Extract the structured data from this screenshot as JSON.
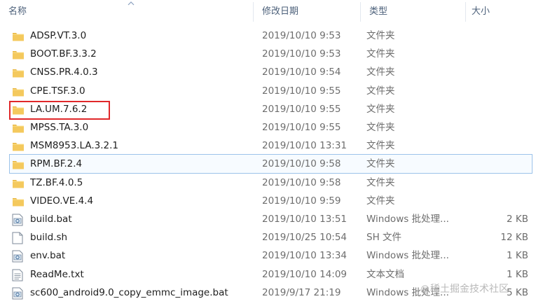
{
  "header": {
    "name": "名称",
    "date": "修改日期",
    "type": "类型",
    "size": "大小"
  },
  "rows": [
    {
      "name": "ADSP.VT.3.0",
      "date": "2019/10/10 9:53",
      "type": "文件夹",
      "size": "",
      "icon": "folder-icon"
    },
    {
      "name": "BOOT.BF.3.3.2",
      "date": "2019/10/10 9:53",
      "type": "文件夹",
      "size": "",
      "icon": "folder-icon"
    },
    {
      "name": "CNSS.PR.4.0.3",
      "date": "2019/10/10 9:54",
      "type": "文件夹",
      "size": "",
      "icon": "folder-icon"
    },
    {
      "name": "CPE.TSF.3.0",
      "date": "2019/10/10 9:55",
      "type": "文件夹",
      "size": "",
      "icon": "folder-icon"
    },
    {
      "name": "LA.UM.7.6.2",
      "date": "2019/10/10 9:55",
      "type": "文件夹",
      "size": "",
      "icon": "folder-icon"
    },
    {
      "name": "MPSS.TA.3.0",
      "date": "2019/10/10 9:55",
      "type": "文件夹",
      "size": "",
      "icon": "folder-icon"
    },
    {
      "name": "MSM8953.LA.3.2.1",
      "date": "2019/10/10 13:31",
      "type": "文件夹",
      "size": "",
      "icon": "folder-icon"
    },
    {
      "name": "RPM.BF.2.4",
      "date": "2019/10/10 9:58",
      "type": "文件夹",
      "size": "",
      "icon": "folder-icon"
    },
    {
      "name": "TZ.BF.4.0.5",
      "date": "2019/10/10 9:58",
      "type": "文件夹",
      "size": "",
      "icon": "folder-icon"
    },
    {
      "name": "VIDEO.VE.4.4",
      "date": "2019/10/10 9:59",
      "type": "文件夹",
      "size": "",
      "icon": "folder-icon"
    },
    {
      "name": "build.bat",
      "date": "2019/10/10 13:51",
      "type": "Windows 批处理...",
      "size": "2 KB",
      "icon": "batch-file-icon"
    },
    {
      "name": "build.sh",
      "date": "2019/10/25 10:54",
      "type": "SH 文件",
      "size": "12 KB",
      "icon": "blank-file-icon"
    },
    {
      "name": "env.bat",
      "date": "2019/10/10 13:34",
      "type": "Windows 批处理...",
      "size": "1 KB",
      "icon": "batch-file-icon"
    },
    {
      "name": "ReadMe.txt",
      "date": "2019/10/10 14:09",
      "type": "文本文档",
      "size": "1 KB",
      "icon": "text-file-icon"
    },
    {
      "name": "sc600_android9.0_copy_emmc_image.bat",
      "date": "2019/9/17 21:19",
      "type": "Windows 批处理...",
      "size": "5 KB",
      "icon": "batch-file-icon"
    }
  ],
  "selected_row": "RPM.BF.2.4",
  "watermark": "稀土掘金技术社区",
  "colors": {
    "header_text": "#4c607a",
    "highlight_box": "#e0282a",
    "selection_border": "#9cc3ea",
    "folder_yellow": "#f4c95d"
  }
}
